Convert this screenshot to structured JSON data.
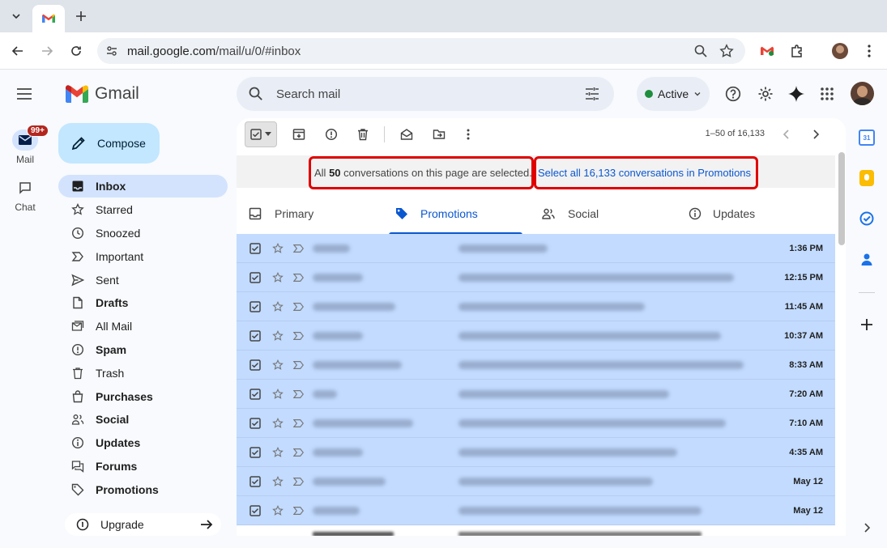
{
  "browser": {
    "url_host": "mail.google.com",
    "url_path": "/mail/u/0/#inbox"
  },
  "rail": {
    "mail_label": "Mail",
    "mail_badge": "99+",
    "chat_label": "Chat"
  },
  "app": {
    "name": "Gmail"
  },
  "compose_label": "Compose",
  "nav": [
    {
      "label": "Inbox",
      "icon": "inbox-icon"
    },
    {
      "label": "Starred",
      "icon": "star-icon"
    },
    {
      "label": "Snoozed",
      "icon": "clock-icon"
    },
    {
      "label": "Important",
      "icon": "important-icon"
    },
    {
      "label": "Sent",
      "icon": "send-icon"
    },
    {
      "label": "Drafts",
      "icon": "draft-icon"
    },
    {
      "label": "All Mail",
      "icon": "all-mail-icon"
    },
    {
      "label": "Spam",
      "icon": "spam-icon"
    },
    {
      "label": "Trash",
      "icon": "trash-icon"
    },
    {
      "label": "Purchases",
      "icon": "bag-icon"
    },
    {
      "label": "Social",
      "icon": "people-icon"
    },
    {
      "label": "Updates",
      "icon": "info-icon"
    },
    {
      "label": "Forums",
      "icon": "forum-icon"
    },
    {
      "label": "Promotions",
      "icon": "tag-icon"
    }
  ],
  "upgrade_label": "Upgrade",
  "search": {
    "placeholder": "Search mail"
  },
  "status": {
    "label": "Active",
    "color": "#1e8e3e"
  },
  "pagination": "1–50 of 16,133",
  "banner": {
    "prefix": "All ",
    "count": "50",
    "suffix": " conversations on this page are selected.",
    "select_all_link": "Select all 16,133 conversations in Promotions"
  },
  "category_tabs": [
    {
      "label": "Primary",
      "icon": "inbox-icon"
    },
    {
      "label": "Promotions",
      "icon": "tag-icon",
      "selected": true
    },
    {
      "label": "Social",
      "icon": "people-icon"
    },
    {
      "label": "Updates",
      "icon": "info-icon"
    }
  ],
  "rows": [
    {
      "time": "1:36 PM"
    },
    {
      "time": "12:15 PM"
    },
    {
      "time": "11:45 AM"
    },
    {
      "time": "10:37 AM"
    },
    {
      "time": "8:33 AM"
    },
    {
      "time": "7:20 AM"
    },
    {
      "time": "7:10 AM"
    },
    {
      "time": "4:35 AM"
    },
    {
      "time": "May 12"
    },
    {
      "time": "May 12"
    }
  ],
  "colors": {
    "accent": "#0b57d0",
    "selected_row": "#c2dbff",
    "compose_bg": "#c2e7ff",
    "highlight_box": "#e00000"
  }
}
